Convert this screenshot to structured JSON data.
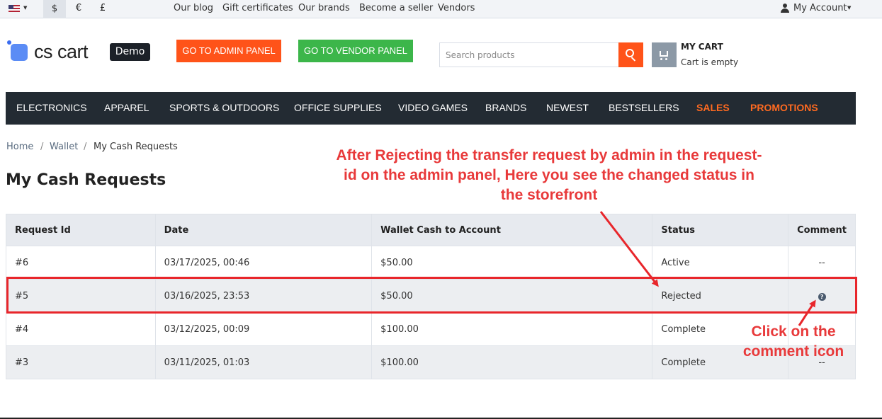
{
  "topbar": {
    "currencies": [
      "$",
      "€",
      "£"
    ],
    "links": [
      "Our blog",
      "Gift certificates",
      "Our brands",
      "Become a seller",
      "Vendors"
    ],
    "account": "My Account"
  },
  "header": {
    "logo": "cs cart",
    "demo": "Demo",
    "admin_btn": "GO TO ADMIN PANEL",
    "vendor_btn": "GO TO VENDOR PANEL",
    "search_placeholder": "Search products",
    "cart_title": "MY CART",
    "cart_status": "Cart is empty"
  },
  "nav": [
    "ELECTRONICS",
    "APPAREL",
    "SPORTS & OUTDOORS",
    "OFFICE SUPPLIES",
    "VIDEO GAMES",
    "BRANDS",
    "NEWEST",
    "BESTSELLERS",
    "SALES",
    "PROMOTIONS"
  ],
  "breadcrumb": [
    "Home",
    "Wallet",
    "My Cash Requests"
  ],
  "page_title": "My Cash Requests",
  "table": {
    "headers": [
      "Request Id",
      "Date",
      "Wallet Cash to Account",
      "Status",
      "Comment"
    ],
    "rows": [
      {
        "id": "#6",
        "date": "03/17/2025, 00:46",
        "amount": "$50.00",
        "status": "Active",
        "comment": "--"
      },
      {
        "id": "#5",
        "date": "03/16/2025, 23:53",
        "amount": "$50.00",
        "status": "Rejected",
        "comment": "?"
      },
      {
        "id": "#4",
        "date": "03/12/2025, 00:09",
        "amount": "$100.00",
        "status": "Complete",
        "comment": "--"
      },
      {
        "id": "#3",
        "date": "03/11/2025, 01:03",
        "amount": "$100.00",
        "status": "Complete",
        "comment": "--"
      }
    ]
  },
  "annotations": {
    "main_note": "After Rejecting the transfer request by admin in the request-id on the admin panel, Here you see the changed status in the storefront",
    "click_note": "Click on the comment icon",
    "color": "#e8262b"
  }
}
